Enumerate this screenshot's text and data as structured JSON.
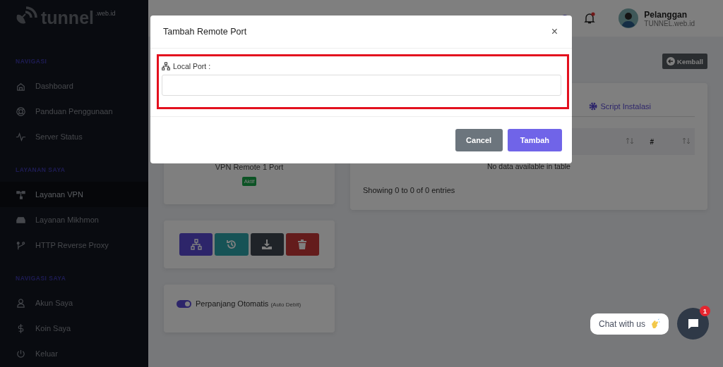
{
  "brand": {
    "name": "tunnel",
    "suffix": ".web.id"
  },
  "sidebar": {
    "sections": [
      {
        "title": "NAVIGASI",
        "items": [
          {
            "label": "Dashboard",
            "selected": false
          },
          {
            "label": "Panduan Penggunaan",
            "selected": false
          },
          {
            "label": "Server Status",
            "selected": false
          }
        ]
      },
      {
        "title": "LAYANAN SAYA",
        "items": [
          {
            "label": "Layanan VPN",
            "selected": true
          },
          {
            "label": "Layanan Mikhmon",
            "selected": false
          },
          {
            "label": "HTTP Reverse Proxy",
            "selected": false
          }
        ]
      },
      {
        "title": "NAVIGASI SAYA",
        "items": [
          {
            "label": "Akun Saya",
            "selected": false
          },
          {
            "label": "Koin Saya",
            "selected": false
          },
          {
            "label": "Keluar",
            "selected": false
          }
        ]
      }
    ]
  },
  "topbar": {
    "notification_dot": true,
    "user": {
      "name": "Pelanggan",
      "subtitle": "TUNNEL.web.id"
    }
  },
  "back_button": "Kemball",
  "service_card": {
    "name": "VPN Remote 1 Port",
    "status": "Aktif"
  },
  "action_buttons": [
    {
      "kind": "network"
    },
    {
      "kind": "history"
    },
    {
      "kind": "download"
    },
    {
      "kind": "delete"
    }
  ],
  "auto_renew": {
    "label": "Perpanjang Otomatis",
    "note": "(Auto Debit)",
    "on": true
  },
  "details": {
    "tab": "Script Instalasi",
    "table": {
      "columns": [
        "",
        "#"
      ],
      "empty_text": "No data available in table",
      "info": "Showing 0 to 0 of 0 entries"
    }
  },
  "modal": {
    "title": "Tambah Remote Port",
    "close": "×",
    "field_label": "Local Port :",
    "buttons": [
      {
        "label": "Cancel",
        "kind": "secondary"
      },
      {
        "label": "Tambah",
        "kind": "primary"
      }
    ]
  },
  "chat": {
    "label": "Chat with us",
    "badge": "1"
  }
}
